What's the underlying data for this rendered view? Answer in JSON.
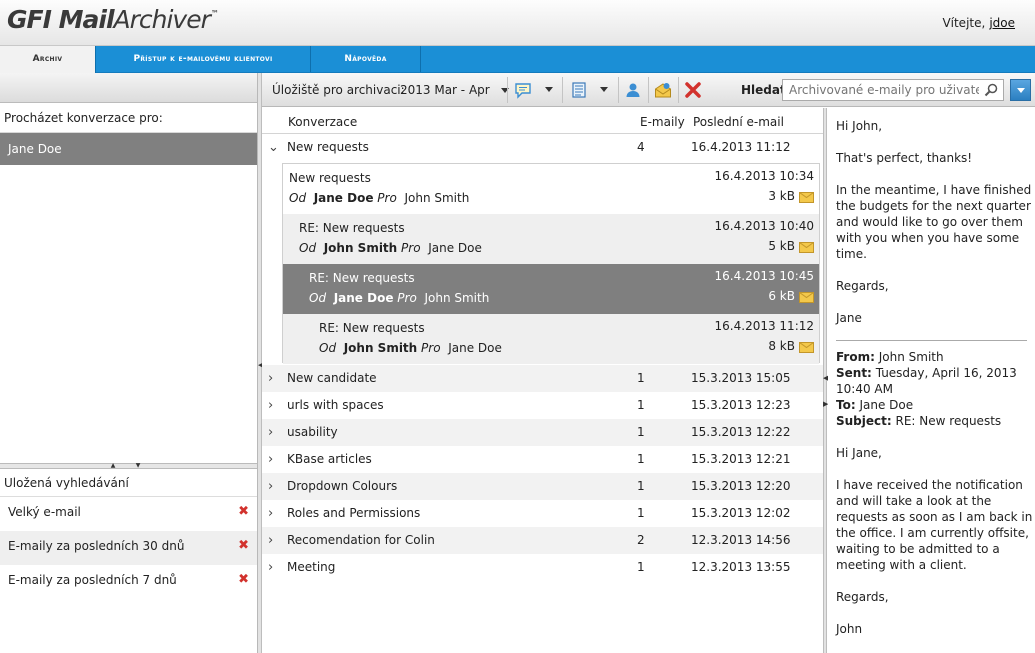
{
  "header": {
    "logo_gfi": "GFI",
    "logo_product_bold": "Mail",
    "logo_product": "Archiver",
    "logo_tm": "™",
    "welcome_label": "Vítejte,",
    "username": "jdoe"
  },
  "tabs": [
    {
      "label": "Archiv",
      "active": true
    },
    {
      "label": "Přístup k e-mailovému klientovi",
      "active": false
    },
    {
      "label": "Nápověda",
      "active": false
    }
  ],
  "left_pane": {
    "browse_label": "Procházet konverzace pro:",
    "selected_user": "Jane Doe",
    "saved_title": "Uložená vyhledávání",
    "saved_searches": [
      {
        "label": "Velký e-mail"
      },
      {
        "label": "E-maily za posledních 30 dnů"
      },
      {
        "label": "E-maily za posledních 7 dnů"
      }
    ]
  },
  "toolbar": {
    "storage_label": "Úložiště pro archivaci:",
    "storage_value": "2013 Mar - Apr",
    "find_label": "Hledat:",
    "search_placeholder": "Archivované e-maily pro uživatele"
  },
  "conversations": {
    "columns": {
      "name": "Konverzace",
      "count": "E-maily",
      "last": "Poslední e-mail"
    },
    "expanded": {
      "name": "New requests",
      "count": "4",
      "date": "16.4.2013 11:12"
    },
    "thread": [
      {
        "subject": "New requests",
        "od": "Od",
        "from": "Jane Doe",
        "pro": "Pro",
        "to": "John Smith",
        "date": "16.4.2013 10:34",
        "size": "3 kB"
      },
      {
        "subject": "RE: New requests",
        "od": "Od",
        "from": "John Smith",
        "pro": "Pro",
        "to": "Jane Doe",
        "date": "16.4.2013 10:40",
        "size": "5 kB"
      },
      {
        "subject": "RE: New requests",
        "od": "Od",
        "from": "Jane Doe",
        "pro": "Pro",
        "to": "John Smith",
        "date": "16.4.2013 10:45",
        "size": "6 kB"
      },
      {
        "subject": "RE: New requests",
        "od": "Od",
        "from": "John Smith",
        "pro": "Pro",
        "to": "Jane Doe",
        "date": "16.4.2013 11:12",
        "size": "8 kB"
      }
    ],
    "rows": [
      {
        "name": "New candidate",
        "count": "1",
        "date": "15.3.2013 15:05"
      },
      {
        "name": "urls with spaces",
        "count": "1",
        "date": "15.3.2013 12:23"
      },
      {
        "name": "usability",
        "count": "1",
        "date": "15.3.2013 12:22"
      },
      {
        "name": "KBase articles",
        "count": "1",
        "date": "15.3.2013 12:21"
      },
      {
        "name": "Dropdown Colours",
        "count": "1",
        "date": "15.3.2013 12:20"
      },
      {
        "name": "Roles and Permissions",
        "count": "1",
        "date": "15.3.2013 12:02"
      },
      {
        "name": "Recomendation for Colin",
        "count": "2",
        "date": "12.3.2013 14:56"
      },
      {
        "name": "Meeting",
        "count": "1",
        "date": "12.3.2013 13:55"
      }
    ]
  },
  "preview": {
    "greeting": "Hi John,",
    "p1": "That's perfect, thanks!",
    "p2": "In the meantime, I have finished the budgets for the next quarter and would like to go over them with you when you have some time.",
    "p3": "Regards,",
    "sig": "Jane",
    "from_label": "From:",
    "from_value": "John Smith",
    "sent_label": "Sent:",
    "sent_value": "Tuesday, April 16, 2013 10:40 AM",
    "to_label": "To:",
    "to_value": "Jane Doe",
    "subject_label": "Subject:",
    "subject_value": "RE: New requests",
    "q_greeting": "Hi Jane,",
    "q_p1": "I have received the notification and will take a look at the requests as soon as I am back in the office. I am currently offsite, waiting to be admitted to a meeting with a client.",
    "q_regards": "Regards,",
    "q_sig": "John"
  },
  "colors": {
    "tab_blue": "#1b8fd6",
    "selected_gray": "#7f7f7f",
    "delete_red": "#d2322d",
    "envelope_yellow": "#f3c84b"
  },
  "icons": [
    "comment-icon",
    "list-view-icon",
    "user-icon",
    "envelope-open-icon",
    "delete-icon",
    "search-icon",
    "envelope-icon"
  ]
}
